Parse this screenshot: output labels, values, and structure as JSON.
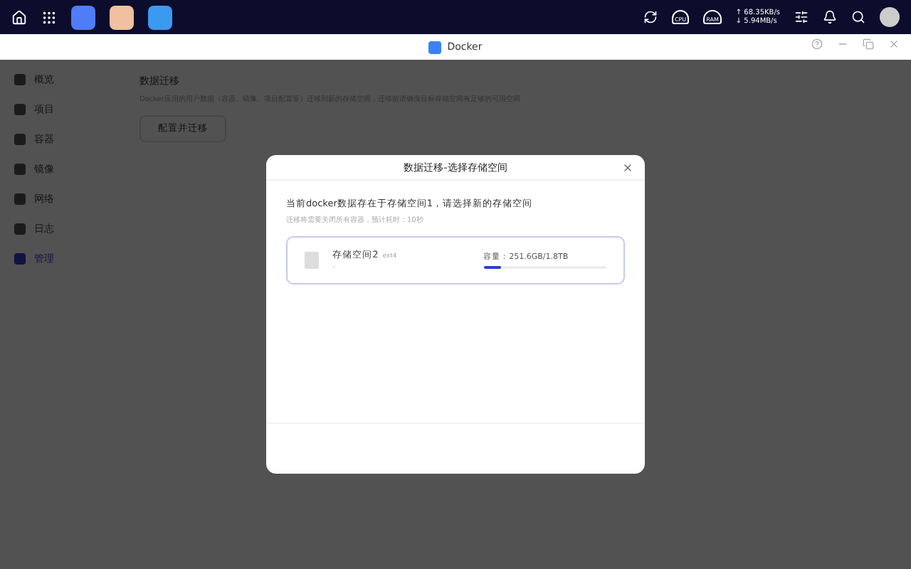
{
  "taskbar": {
    "upload_speed": "↑ 68.35KB/s",
    "download_speed": "↓ 5.94MB/s",
    "gauges": [
      "CPU",
      "RAM"
    ]
  },
  "window": {
    "title": "Docker"
  },
  "sidebar": {
    "items": [
      {
        "label": "概览",
        "selected": false
      },
      {
        "label": "项目",
        "selected": false
      },
      {
        "label": "容器",
        "selected": false
      },
      {
        "label": "镜像",
        "selected": false
      },
      {
        "label": "网络",
        "selected": false
      },
      {
        "label": "日志",
        "selected": false
      },
      {
        "label": "管理",
        "selected": true
      }
    ]
  },
  "section": {
    "title": "数据迁移",
    "description": "Docker应用的用户数据（容器、镜像、项目配置等）迁移到新的存储空间，迁移前请确保目标存储空间有足够的可用空间",
    "button": "配置并迁移"
  },
  "dialog": {
    "title": "数据迁移-选择存储空间",
    "message": "当前docker数据存在于存储空间1，请选择新的存储空间",
    "hint": "迁移将需要关闭所有容器，预计耗时：10秒",
    "volumes": [
      {
        "name": "存储空间2",
        "fs": "ext4",
        "detail": "-",
        "capacity": "容量：251.6GB/1.8TB",
        "level": 0.14,
        "selected": true
      }
    ]
  }
}
